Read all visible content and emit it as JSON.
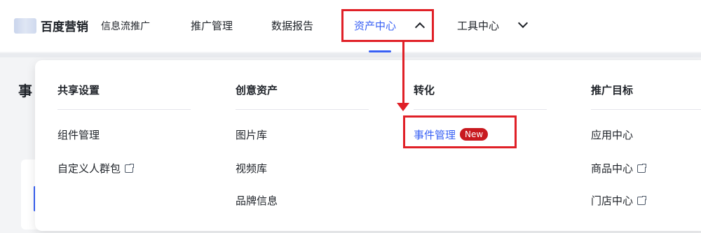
{
  "header": {
    "brand": "百度营销",
    "product": "信息流推广",
    "nav": [
      {
        "label": "推广管理"
      },
      {
        "label": "数据报告"
      },
      {
        "label": "资产中心",
        "active": true
      },
      {
        "label": "工具中心"
      }
    ]
  },
  "page": {
    "title_partial": "事"
  },
  "dropdown": {
    "columns": [
      {
        "title": "共享设置",
        "items": [
          "组件管理",
          "自定义人群包"
        ]
      },
      {
        "title": "创意资产",
        "items": [
          "图片库",
          "视频库",
          "品牌信息"
        ]
      },
      {
        "title": "转化",
        "items": [
          "事件管理"
        ]
      },
      {
        "title": "推广目标",
        "items": [
          "应用中心",
          "商品中心",
          "门店中心"
        ]
      }
    ],
    "badge": "New"
  },
  "colors": {
    "accent": "#3860f4",
    "annotation": "#e02027",
    "badge_bg": "#c8191f",
    "text": "#1f2329"
  },
  "icons": {
    "external_link": "external-link-icon",
    "nav_open": "chevron-up-icon",
    "nav_closed": "chevron-down-icon"
  }
}
